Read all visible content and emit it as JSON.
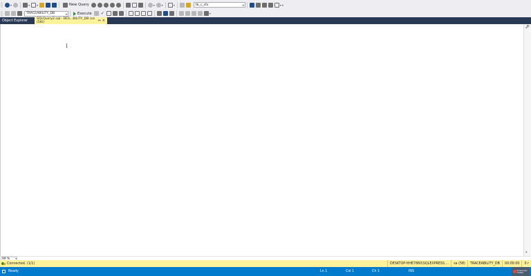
{
  "toolbar1": {
    "new_query_label": "New Query",
    "procedure_combo": "tb_c_sfo"
  },
  "toolbar2": {
    "database_combo": "TRACEABILITY_DB",
    "execute_label": "Execute"
  },
  "tabs": {
    "object_explorer": "Object Explorer",
    "query_tab": "SQLQuery2.sql - DES...BILITY_DB (sa (58))",
    "pin": "⇔",
    "close": "×"
  },
  "editor": {
    "cursor": "I"
  },
  "zoom": {
    "value": "99 %"
  },
  "connection": {
    "status": "Connected. (1/1)",
    "server": "DESKTOP-HHE7860\\SQLEXPRESS ...",
    "user": "sa (58)",
    "database": "TRACEABILITY_DB",
    "elapsed": "00:00:00",
    "rows": "0 r"
  },
  "status": {
    "ready": "Ready",
    "line": "Ln 1",
    "col": "Col 1",
    "ch": "Ch 1",
    "mode": "INS"
  },
  "watermark": {
    "text": "Screencast-O-Matic"
  }
}
